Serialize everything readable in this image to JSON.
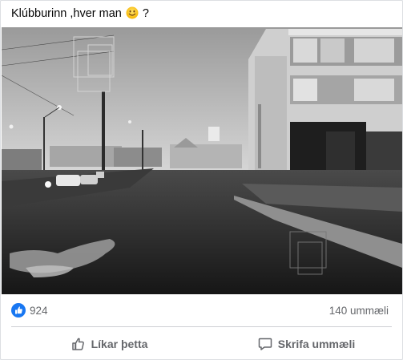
{
  "post": {
    "text_before": "Klúbburinn ,hver man",
    "text_after": "?",
    "emoji": "smiling-face-icon"
  },
  "photo": {
    "description_icon": "black-and-white-street-photo"
  },
  "stats": {
    "reaction_icon": "thumbs-up-icon",
    "reaction_color": "#1877f2",
    "likes": "924",
    "comments": "140 ummæli"
  },
  "actions": {
    "like_label": "Líkar þetta",
    "comment_label": "Skrifa ummæli"
  }
}
